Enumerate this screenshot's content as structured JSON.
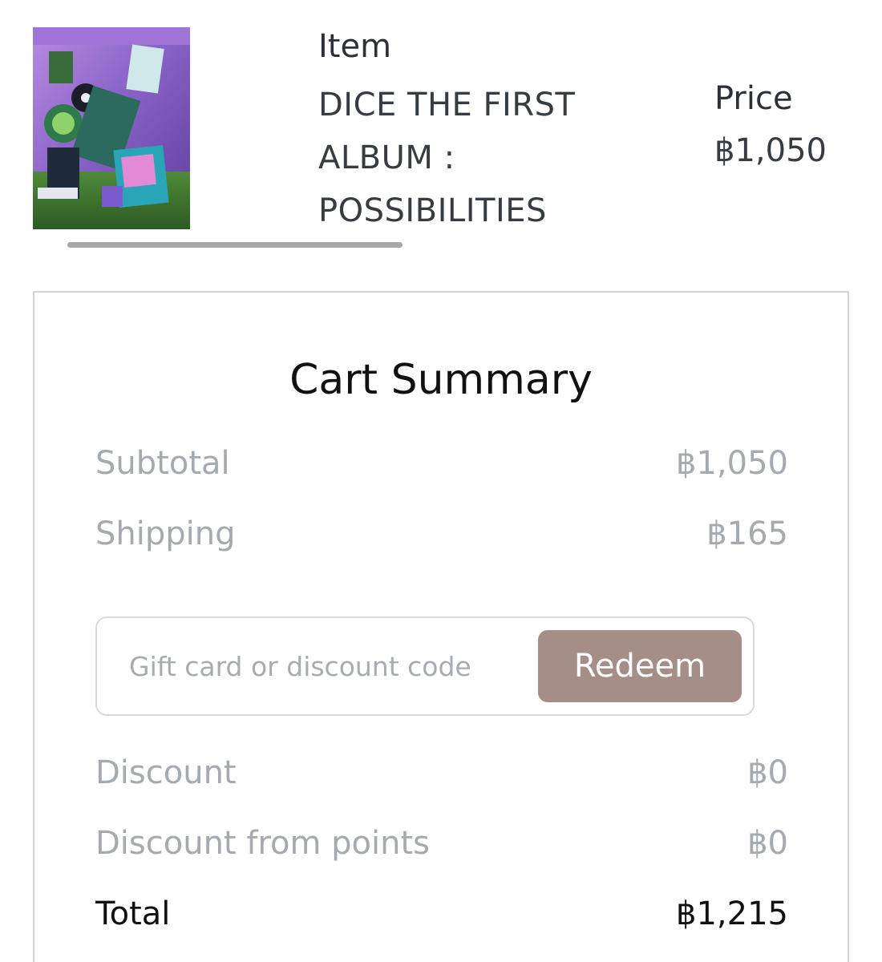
{
  "product": {
    "image_icon": "album-cover-image",
    "item_header": "Item",
    "item_name_lines": [
      "DICE THE FIRST",
      "ALBUM :",
      "POSSIBILITIES"
    ],
    "price_header": "Price",
    "price": "฿1,050"
  },
  "summary": {
    "title": "Cart Summary",
    "subtotal_label": "Subtotal",
    "subtotal_value": "฿1,050",
    "shipping_label": "Shipping",
    "shipping_value": "฿165",
    "coupon_placeholder": "Gift card or discount code",
    "redeem_label": "Redeem",
    "discount_label": "Discount",
    "discount_value": "฿0",
    "points_label": "Discount from points",
    "points_value": "฿0",
    "total_label": "Total",
    "total_value": "฿1,215"
  },
  "colors": {
    "redeem_button": "#a58e87",
    "muted_text": "#a4aab0",
    "card_border": "#cfd4d8"
  }
}
